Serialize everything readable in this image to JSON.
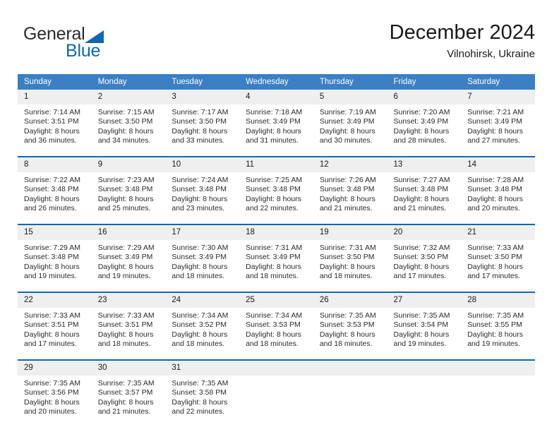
{
  "brand": {
    "name_part1": "General",
    "name_part2": "Blue",
    "accent_color": "#1167b1"
  },
  "header": {
    "title": "December 2024",
    "subtitle": "Vilnohirsk, Ukraine"
  },
  "calendar": {
    "header_color": "#3b7fc4",
    "daynum_band_color": "#efefef",
    "weekday_headers": [
      "Sunday",
      "Monday",
      "Tuesday",
      "Wednesday",
      "Thursday",
      "Friday",
      "Saturday"
    ],
    "weeks": [
      [
        {
          "day": "1",
          "sunrise": "Sunrise: 7:14 AM",
          "sunset": "Sunset: 3:51 PM",
          "daylight_line1": "Daylight: 8 hours",
          "daylight_line2": "and 36 minutes."
        },
        {
          "day": "2",
          "sunrise": "Sunrise: 7:15 AM",
          "sunset": "Sunset: 3:50 PM",
          "daylight_line1": "Daylight: 8 hours",
          "daylight_line2": "and 34 minutes."
        },
        {
          "day": "3",
          "sunrise": "Sunrise: 7:17 AM",
          "sunset": "Sunset: 3:50 PM",
          "daylight_line1": "Daylight: 8 hours",
          "daylight_line2": "and 33 minutes."
        },
        {
          "day": "4",
          "sunrise": "Sunrise: 7:18 AM",
          "sunset": "Sunset: 3:49 PM",
          "daylight_line1": "Daylight: 8 hours",
          "daylight_line2": "and 31 minutes."
        },
        {
          "day": "5",
          "sunrise": "Sunrise: 7:19 AM",
          "sunset": "Sunset: 3:49 PM",
          "daylight_line1": "Daylight: 8 hours",
          "daylight_line2": "and 30 minutes."
        },
        {
          "day": "6",
          "sunrise": "Sunrise: 7:20 AM",
          "sunset": "Sunset: 3:49 PM",
          "daylight_line1": "Daylight: 8 hours",
          "daylight_line2": "and 28 minutes."
        },
        {
          "day": "7",
          "sunrise": "Sunrise: 7:21 AM",
          "sunset": "Sunset: 3:49 PM",
          "daylight_line1": "Daylight: 8 hours",
          "daylight_line2": "and 27 minutes."
        }
      ],
      [
        {
          "day": "8",
          "sunrise": "Sunrise: 7:22 AM",
          "sunset": "Sunset: 3:48 PM",
          "daylight_line1": "Daylight: 8 hours",
          "daylight_line2": "and 26 minutes."
        },
        {
          "day": "9",
          "sunrise": "Sunrise: 7:23 AM",
          "sunset": "Sunset: 3:48 PM",
          "daylight_line1": "Daylight: 8 hours",
          "daylight_line2": "and 25 minutes."
        },
        {
          "day": "10",
          "sunrise": "Sunrise: 7:24 AM",
          "sunset": "Sunset: 3:48 PM",
          "daylight_line1": "Daylight: 8 hours",
          "daylight_line2": "and 23 minutes."
        },
        {
          "day": "11",
          "sunrise": "Sunrise: 7:25 AM",
          "sunset": "Sunset: 3:48 PM",
          "daylight_line1": "Daylight: 8 hours",
          "daylight_line2": "and 22 minutes."
        },
        {
          "day": "12",
          "sunrise": "Sunrise: 7:26 AM",
          "sunset": "Sunset: 3:48 PM",
          "daylight_line1": "Daylight: 8 hours",
          "daylight_line2": "and 21 minutes."
        },
        {
          "day": "13",
          "sunrise": "Sunrise: 7:27 AM",
          "sunset": "Sunset: 3:48 PM",
          "daylight_line1": "Daylight: 8 hours",
          "daylight_line2": "and 21 minutes."
        },
        {
          "day": "14",
          "sunrise": "Sunrise: 7:28 AM",
          "sunset": "Sunset: 3:48 PM",
          "daylight_line1": "Daylight: 8 hours",
          "daylight_line2": "and 20 minutes."
        }
      ],
      [
        {
          "day": "15",
          "sunrise": "Sunrise: 7:29 AM",
          "sunset": "Sunset: 3:48 PM",
          "daylight_line1": "Daylight: 8 hours",
          "daylight_line2": "and 19 minutes."
        },
        {
          "day": "16",
          "sunrise": "Sunrise: 7:29 AM",
          "sunset": "Sunset: 3:49 PM",
          "daylight_line1": "Daylight: 8 hours",
          "daylight_line2": "and 19 minutes."
        },
        {
          "day": "17",
          "sunrise": "Sunrise: 7:30 AM",
          "sunset": "Sunset: 3:49 PM",
          "daylight_line1": "Daylight: 8 hours",
          "daylight_line2": "and 18 minutes."
        },
        {
          "day": "18",
          "sunrise": "Sunrise: 7:31 AM",
          "sunset": "Sunset: 3:49 PM",
          "daylight_line1": "Daylight: 8 hours",
          "daylight_line2": "and 18 minutes."
        },
        {
          "day": "19",
          "sunrise": "Sunrise: 7:31 AM",
          "sunset": "Sunset: 3:50 PM",
          "daylight_line1": "Daylight: 8 hours",
          "daylight_line2": "and 18 minutes."
        },
        {
          "day": "20",
          "sunrise": "Sunrise: 7:32 AM",
          "sunset": "Sunset: 3:50 PM",
          "daylight_line1": "Daylight: 8 hours",
          "daylight_line2": "and 17 minutes."
        },
        {
          "day": "21",
          "sunrise": "Sunrise: 7:33 AM",
          "sunset": "Sunset: 3:50 PM",
          "daylight_line1": "Daylight: 8 hours",
          "daylight_line2": "and 17 minutes."
        }
      ],
      [
        {
          "day": "22",
          "sunrise": "Sunrise: 7:33 AM",
          "sunset": "Sunset: 3:51 PM",
          "daylight_line1": "Daylight: 8 hours",
          "daylight_line2": "and 17 minutes."
        },
        {
          "day": "23",
          "sunrise": "Sunrise: 7:33 AM",
          "sunset": "Sunset: 3:51 PM",
          "daylight_line1": "Daylight: 8 hours",
          "daylight_line2": "and 18 minutes."
        },
        {
          "day": "24",
          "sunrise": "Sunrise: 7:34 AM",
          "sunset": "Sunset: 3:52 PM",
          "daylight_line1": "Daylight: 8 hours",
          "daylight_line2": "and 18 minutes."
        },
        {
          "day": "25",
          "sunrise": "Sunrise: 7:34 AM",
          "sunset": "Sunset: 3:53 PM",
          "daylight_line1": "Daylight: 8 hours",
          "daylight_line2": "and 18 minutes."
        },
        {
          "day": "26",
          "sunrise": "Sunrise: 7:35 AM",
          "sunset": "Sunset: 3:53 PM",
          "daylight_line1": "Daylight: 8 hours",
          "daylight_line2": "and 18 minutes."
        },
        {
          "day": "27",
          "sunrise": "Sunrise: 7:35 AM",
          "sunset": "Sunset: 3:54 PM",
          "daylight_line1": "Daylight: 8 hours",
          "daylight_line2": "and 19 minutes."
        },
        {
          "day": "28",
          "sunrise": "Sunrise: 7:35 AM",
          "sunset": "Sunset: 3:55 PM",
          "daylight_line1": "Daylight: 8 hours",
          "daylight_line2": "and 19 minutes."
        }
      ],
      [
        {
          "day": "29",
          "sunrise": "Sunrise: 7:35 AM",
          "sunset": "Sunset: 3:56 PM",
          "daylight_line1": "Daylight: 8 hours",
          "daylight_line2": "and 20 minutes."
        },
        {
          "day": "30",
          "sunrise": "Sunrise: 7:35 AM",
          "sunset": "Sunset: 3:57 PM",
          "daylight_line1": "Daylight: 8 hours",
          "daylight_line2": "and 21 minutes."
        },
        {
          "day": "31",
          "sunrise": "Sunrise: 7:35 AM",
          "sunset": "Sunset: 3:58 PM",
          "daylight_line1": "Daylight: 8 hours",
          "daylight_line2": "and 22 minutes."
        },
        {
          "day": "",
          "sunrise": "",
          "sunset": "",
          "daylight_line1": "",
          "daylight_line2": ""
        },
        {
          "day": "",
          "sunrise": "",
          "sunset": "",
          "daylight_line1": "",
          "daylight_line2": ""
        },
        {
          "day": "",
          "sunrise": "",
          "sunset": "",
          "daylight_line1": "",
          "daylight_line2": ""
        },
        {
          "day": "",
          "sunrise": "",
          "sunset": "",
          "daylight_line1": "",
          "daylight_line2": ""
        }
      ]
    ]
  }
}
